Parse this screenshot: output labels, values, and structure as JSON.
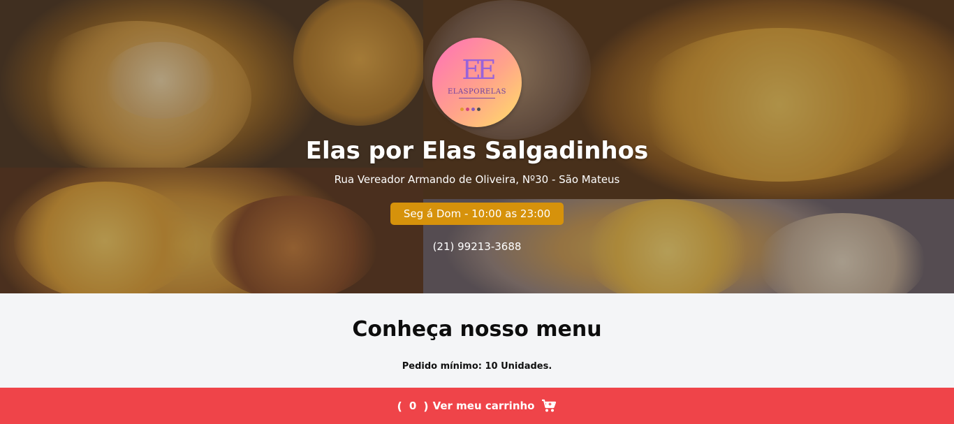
{
  "store": {
    "logo_text": "EE",
    "logo_brand": "ELASPORELAS",
    "name": "Elas por Elas Salgadinhos",
    "address": "Rua Vereador Armando de Oliveira, Nº30 - São Mateus",
    "hours": "Seg á Dom - 10:00 as 23:00",
    "phone": "(21) 99213-3688"
  },
  "menu": {
    "title": "Conheça nosso menu",
    "min_order": "Pedido mínimo: 10 Unidades."
  },
  "cart": {
    "open_paren": "(",
    "count": "0",
    "close_paren": ")",
    "label": "Ver meu carrinho",
    "icon": "cart-icon"
  },
  "colors": {
    "hours_badge": "#d6920b",
    "cart_bar": "#ef4449",
    "logo_gradient_start": "#ff6fb8",
    "logo_gradient_end": "#ffe067"
  }
}
